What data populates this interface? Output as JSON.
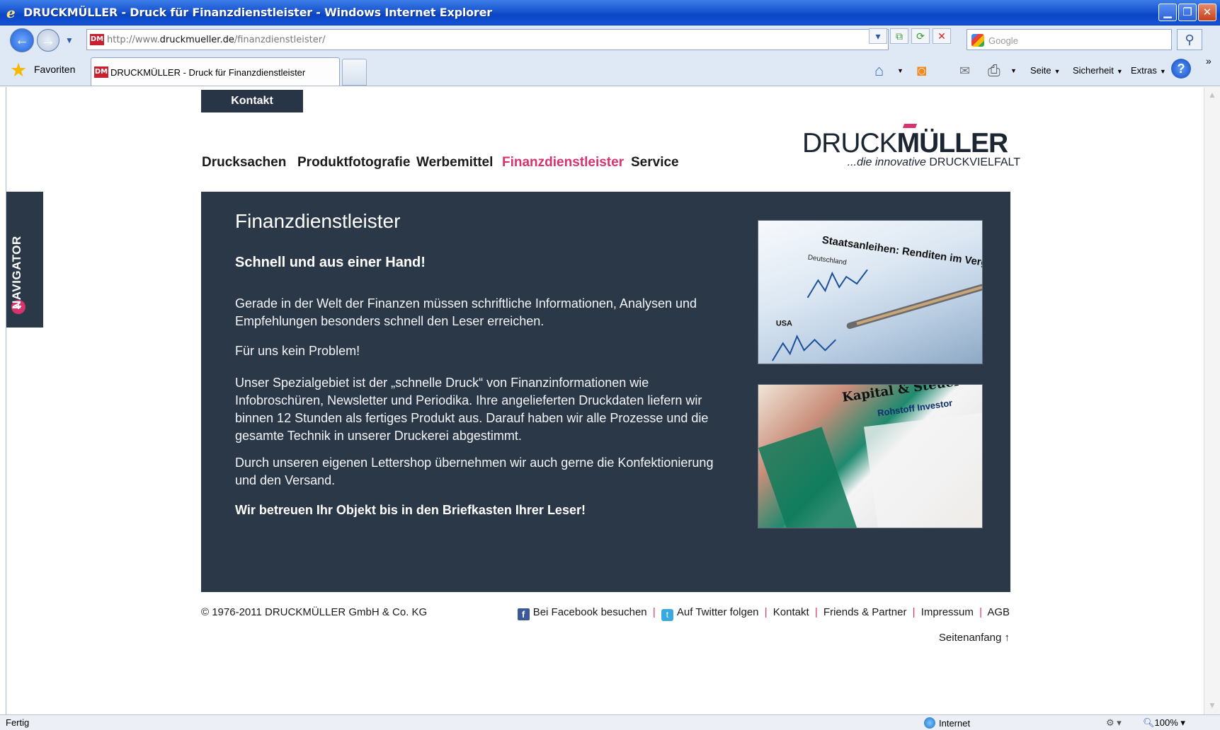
{
  "window": {
    "title": "DRUCKMÜLLER - Druck für Finanzdienstleister - Windows Internet Explorer",
    "min_glyph": "▁",
    "max_glyph": "❐",
    "close_glyph": "✕"
  },
  "address": {
    "url_prefix": "http://www.",
    "url_domain": "druckmueller.de",
    "url_path": "/finanzdienstleister/",
    "search_placeholder": "Google",
    "favicon_text": "DM"
  },
  "toolbar": {
    "favorites_label": "Favoriten",
    "tab_title": "DRUCKMÜLLER - Druck für Finanzdienstleister",
    "seite_label": "Seite",
    "sicherheit_label": "Sicherheit",
    "extras_label": "Extras",
    "help_glyph": "?"
  },
  "page": {
    "kontakt_tab": "Kontakt",
    "nav": [
      {
        "label": "Drucksachen",
        "active": false
      },
      {
        "label": "Produktfotografie",
        "active": false
      },
      {
        "label": "Werbemittel",
        "active": false
      },
      {
        "label": "Finanzdienstleister",
        "active": true
      },
      {
        "label": "Service",
        "active": false
      }
    ],
    "logo": {
      "word_thin": "DRUCK",
      "word_bold": "MÜLLER",
      "tagline_italic": "...die innovative",
      "tagline_plain": "DRUCKVIELFALT"
    },
    "navigator_label": "NAVIGATOR",
    "content": {
      "heading": "Finanzdienstleister",
      "subheading": "Schnell und aus einer Hand!",
      "p1": "Gerade in der Welt der Finanzen müssen schriftliche Informationen, Analysen und Empfehlungen besonders schnell den Leser erreichen.",
      "p2": "Für uns kein Problem!",
      "p3": "Unser Spezialgebiet ist der „schnelle Druck“ von Finanzinformationen wie Infobroschüren, Newsletter und Periodika. Ihre angelieferten Druckdaten liefern wir binnen 12 Stunden als fertiges Produkt aus. Darauf haben wir alle Prozesse und die gesamte Technik in unserer Druckerei abgestimmt.",
      "p4": "Durch unseren eigenen Lettershop übernehmen wir auch gerne die Konfektionierung und den Versand.",
      "p5": "Wir betreuen Ihr Objekt bis in den Briefkasten Ihrer Leser!"
    },
    "image1_text": {
      "headline": "Staatsanleihen: Renditen im Vergl",
      "label_de": "Deutschland",
      "label_usa": "USA"
    },
    "image2_text": {
      "headline": "Kapital & Steuer",
      "sub": "Rohstoff Investor"
    },
    "footer": {
      "copyright": "© 1976-2011 DRUCKMÜLLER GmbH & Co. KG",
      "facebook": "Bei Facebook besuchen",
      "twitter": "Auf Twitter folgen",
      "kontakt": "Kontakt",
      "friends": "Friends & Partner",
      "impressum": "Impressum",
      "agb": "AGB",
      "separator": "|",
      "pagetop": "Seitenanfang ↑"
    }
  },
  "status": {
    "left": "Fertig",
    "zone": "Internet",
    "zoom": "100%"
  },
  "colors": {
    "accent": "#d7336d",
    "panel": "#2b3848",
    "kontakt_tab": "#283546"
  }
}
